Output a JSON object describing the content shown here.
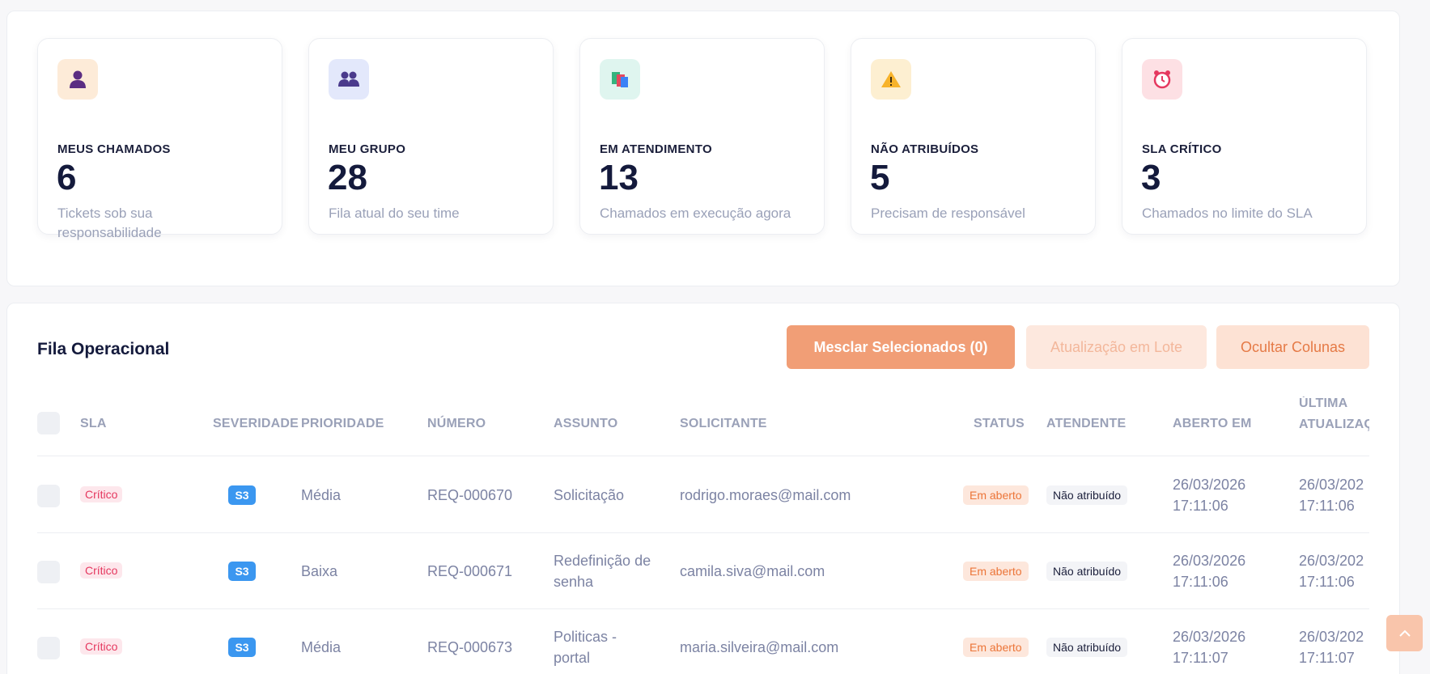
{
  "stats": [
    {
      "icon": "person-icon",
      "title": "MEUS CHAMADOS",
      "value": "6",
      "subtitle": "Tickets sob sua responsabilidade",
      "icon_bg": "#fdebd8"
    },
    {
      "icon": "group-icon",
      "title": "MEU GRUPO",
      "value": "28",
      "subtitle": "Fila atual do seu time",
      "icon_bg": "#e3e8fb"
    },
    {
      "icon": "books-icon",
      "title": "EM ATENDIMENTO",
      "value": "13",
      "subtitle": "Chamados em execução agora",
      "icon_bg": "#dff5ef"
    },
    {
      "icon": "warning-icon",
      "title": "NÃO ATRIBUÍDOS",
      "value": "5",
      "subtitle": "Precisam de responsável",
      "icon_bg": "#fdefd1"
    },
    {
      "icon": "alarm-clock-icon",
      "title": "SLA CRÍTICO",
      "value": "3",
      "subtitle": "Chamados no limite do SLA",
      "icon_bg": "#fde0e4"
    }
  ],
  "queue": {
    "title": "Fila Operacional",
    "buttons": {
      "merge": "Mesclar Selecionados (0)",
      "batch": "Atualização em Lote",
      "hide": "Ocultar Colunas"
    },
    "columns": {
      "sla": "SLA",
      "severity": "SEVERIDADE",
      "priority": "PRIORIDADE",
      "number": "NÚMERO",
      "subject": "ASSUNTO",
      "requester": "SOLICITANTE",
      "status": "STATUS",
      "agent": "ATENDENTE",
      "opened": "ABERTO EM",
      "updated_line1": "ÚLTIMA",
      "updated_line2": "ATUALIZAÇ"
    },
    "rows": [
      {
        "sla": "Crítico",
        "severity": "S3",
        "priority": "Média",
        "number": "REQ-000670",
        "subject_l1": "Solicitação",
        "subject_l2": "",
        "requester": "rodrigo.moraes@mail.com",
        "status": "Em aberto",
        "agent": "Não atribuído",
        "opened_date": "26/03/2026",
        "opened_time": "17:11:06",
        "updated_date": "26/03/202",
        "updated_time": "17:11:06"
      },
      {
        "sla": "Crítico",
        "severity": "S3",
        "priority": "Baixa",
        "number": "REQ-000671",
        "subject_l1": "Redefinição de",
        "subject_l2": "senha",
        "requester": "camila.siva@mail.com",
        "status": "Em aberto",
        "agent": "Não atribuído",
        "opened_date": "26/03/2026",
        "opened_time": "17:11:06",
        "updated_date": "26/03/202",
        "updated_time": "17:11:06"
      },
      {
        "sla": "Crítico",
        "severity": "S3",
        "priority": "Média",
        "number": "REQ-000673",
        "subject_l1": "Politicas -",
        "subject_l2": "portal",
        "requester": "maria.silveira@mail.com",
        "status": "Em aberto",
        "agent": "Não atribuído",
        "opened_date": "26/03/2026",
        "opened_time": "17:11:07",
        "updated_date": "26/03/202",
        "updated_time": "17:11:07"
      }
    ]
  }
}
